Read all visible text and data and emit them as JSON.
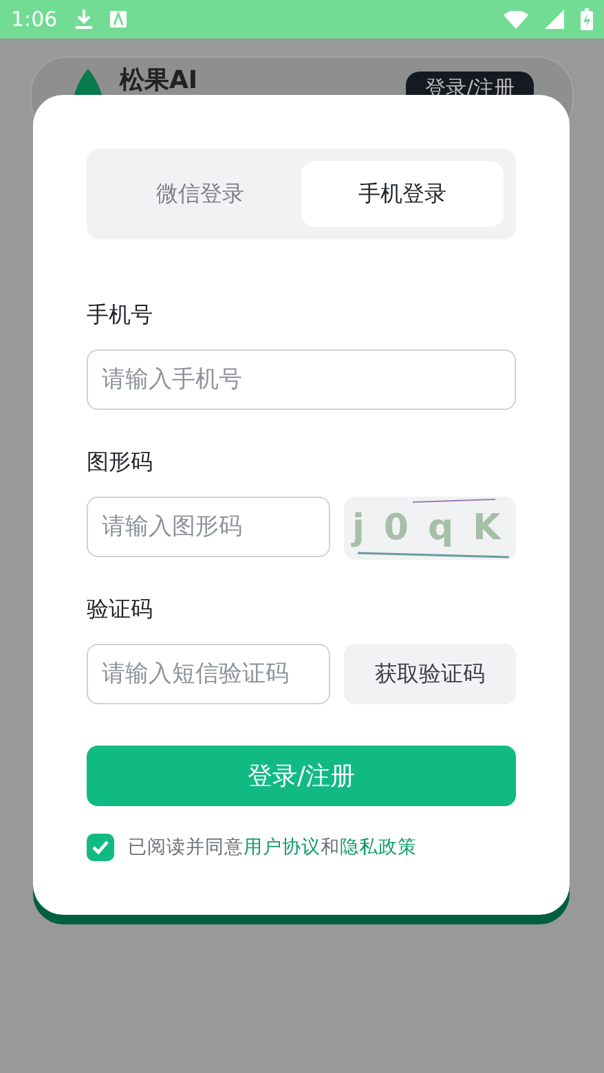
{
  "status_bar": {
    "time": "1:06"
  },
  "background_header": {
    "brand": "松果AI",
    "button": "登录/注册"
  },
  "dialog": {
    "tabs": [
      {
        "label": "微信登录",
        "selected": false
      },
      {
        "label": "手机登录",
        "selected": true
      }
    ],
    "fields": [
      {
        "label": "手机号",
        "placeholder": "请输入手机号",
        "kind": "plain"
      },
      {
        "label": "图形码",
        "placeholder": "请输入图形码",
        "kind": "captcha",
        "captcha": "j0qK"
      },
      {
        "label": "验证码",
        "placeholder": "请输入短信验证码",
        "kind": "sms",
        "button": "获取验证码"
      }
    ],
    "submit": "登录/注册",
    "agreement": {
      "checked": true,
      "text": "已阅读并同意",
      "link_1": "用户协议",
      "joiner": "和",
      "link_2": "隐私政策"
    }
  }
}
